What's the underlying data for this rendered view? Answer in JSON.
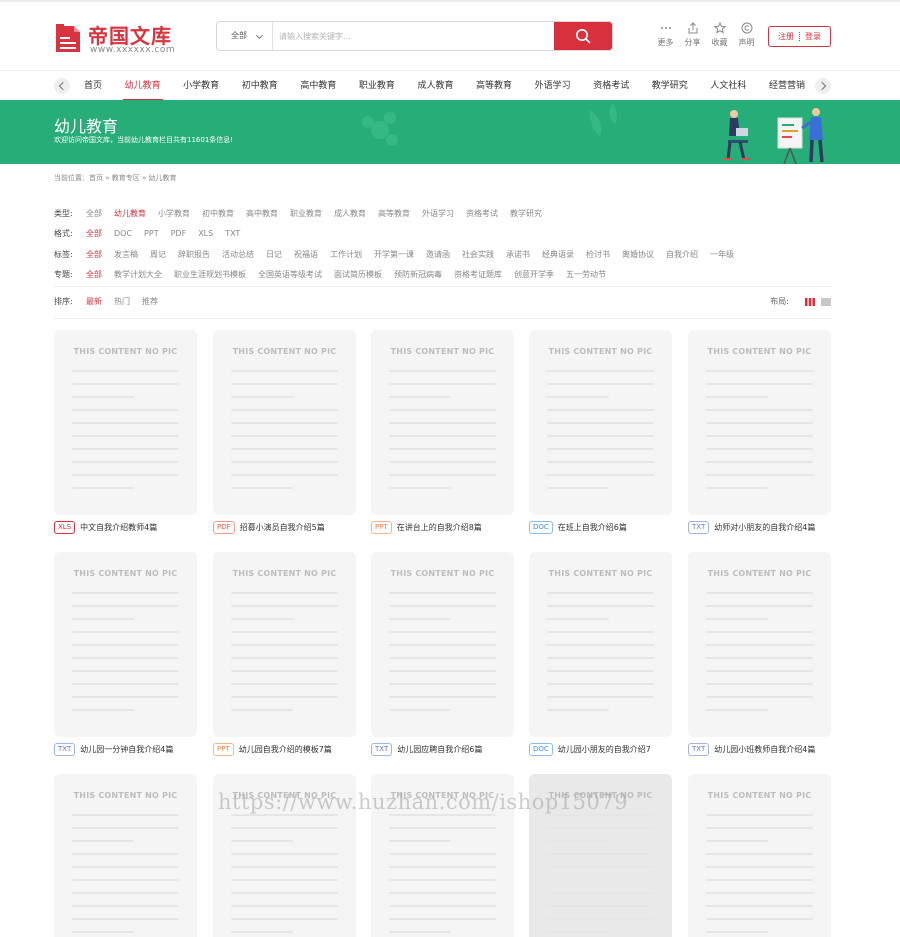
{
  "header": {
    "logo_title": "帝国文库",
    "logo_sub": "www.xxxxxx.com",
    "search_scope": "全部",
    "search_placeholder": "请输入搜索关键字...",
    "icons": [
      {
        "label": "更多",
        "icon": "more-icon"
      },
      {
        "label": "分享",
        "icon": "share-icon"
      },
      {
        "label": "收藏",
        "icon": "star-icon"
      },
      {
        "label": "声明",
        "icon": "copyright-icon"
      }
    ],
    "register": "注册",
    "login": "登录",
    "accent": "#d9303e"
  },
  "nav": {
    "items": [
      "首页",
      "幼儿教育",
      "小学教育",
      "初中教育",
      "高中教育",
      "职业教育",
      "成人教育",
      "高等教育",
      "外语学习",
      "资格考试",
      "教学研究",
      "人文社科",
      "经营营销"
    ],
    "active": 1
  },
  "banner": {
    "title": "幼儿教育",
    "subtitle": "欢迎访问帝国文库，当前幼儿教育栏目共有11601条信息!",
    "color": "#27ae78"
  },
  "breadcrumb": "当前位置：首页 » 教育专区 » 幼儿教育",
  "filters": [
    {
      "label": "类型:",
      "options": [
        "全部",
        "幼儿教育",
        "小学教育",
        "初中教育",
        "高中教育",
        "职业教育",
        "成人教育",
        "高等教育",
        "外语学习",
        "资格考试",
        "教学研究"
      ],
      "active": 1
    },
    {
      "label": "格式:",
      "options": [
        "全部",
        "DOC",
        "PPT",
        "PDF",
        "XLS",
        "TXT"
      ],
      "active": 0
    },
    {
      "label": "标签:",
      "options": [
        "全部",
        "发言稿",
        "周记",
        "辞职报告",
        "活动总结",
        "日记",
        "祝福语",
        "工作计划",
        "开学第一课",
        "邀请函",
        "社会实践",
        "承诺书",
        "经典语录",
        "检讨书",
        "离婚协议",
        "自我介绍",
        "一年级"
      ],
      "active": 0
    },
    {
      "label": "专题:",
      "options": [
        "全部",
        "教学计划大全",
        "职业生涯规划书模板",
        "全国英语等级考试",
        "面试简历模板",
        "预防新冠病毒",
        "资格考证题库",
        "创意开学季",
        "五一劳动节"
      ],
      "active": 0
    }
  ],
  "sort": {
    "label": "排序:",
    "options": [
      "最新",
      "热门",
      "推荐"
    ],
    "active": 0
  },
  "layout_label": "布局:",
  "no_pic_text": "THIS CONTENT NO PIC",
  "cards": [
    {
      "format": "XLS",
      "title": "中文自我介绍教师4篇"
    },
    {
      "format": "PDF",
      "title": "招募小演员自我介绍5篇"
    },
    {
      "format": "PPT",
      "title": "在讲台上的自我介绍8篇"
    },
    {
      "format": "DOC",
      "title": "在班上自我介绍6篇"
    },
    {
      "format": "TXT",
      "title": "幼师对小朋友的自我介绍4篇"
    },
    {
      "format": "TXT",
      "title": "幼儿园一分钟自我介绍4篇"
    },
    {
      "format": "PPT",
      "title": "幼儿园自我介绍的模板7篇"
    },
    {
      "format": "TXT",
      "title": "幼儿园应聘自我介绍6篇"
    },
    {
      "format": "DOC",
      "title": "幼儿园小朋友的自我介绍7"
    },
    {
      "format": "TXT",
      "title": "幼儿园小班教师自我介绍4篇"
    },
    {
      "format": "",
      "title": ""
    },
    {
      "format": "",
      "title": ""
    },
    {
      "format": "",
      "title": ""
    },
    {
      "format": "",
      "title": ""
    },
    {
      "format": "",
      "title": ""
    }
  ],
  "watermark": "https://www.huzhan.com/ishop15079"
}
